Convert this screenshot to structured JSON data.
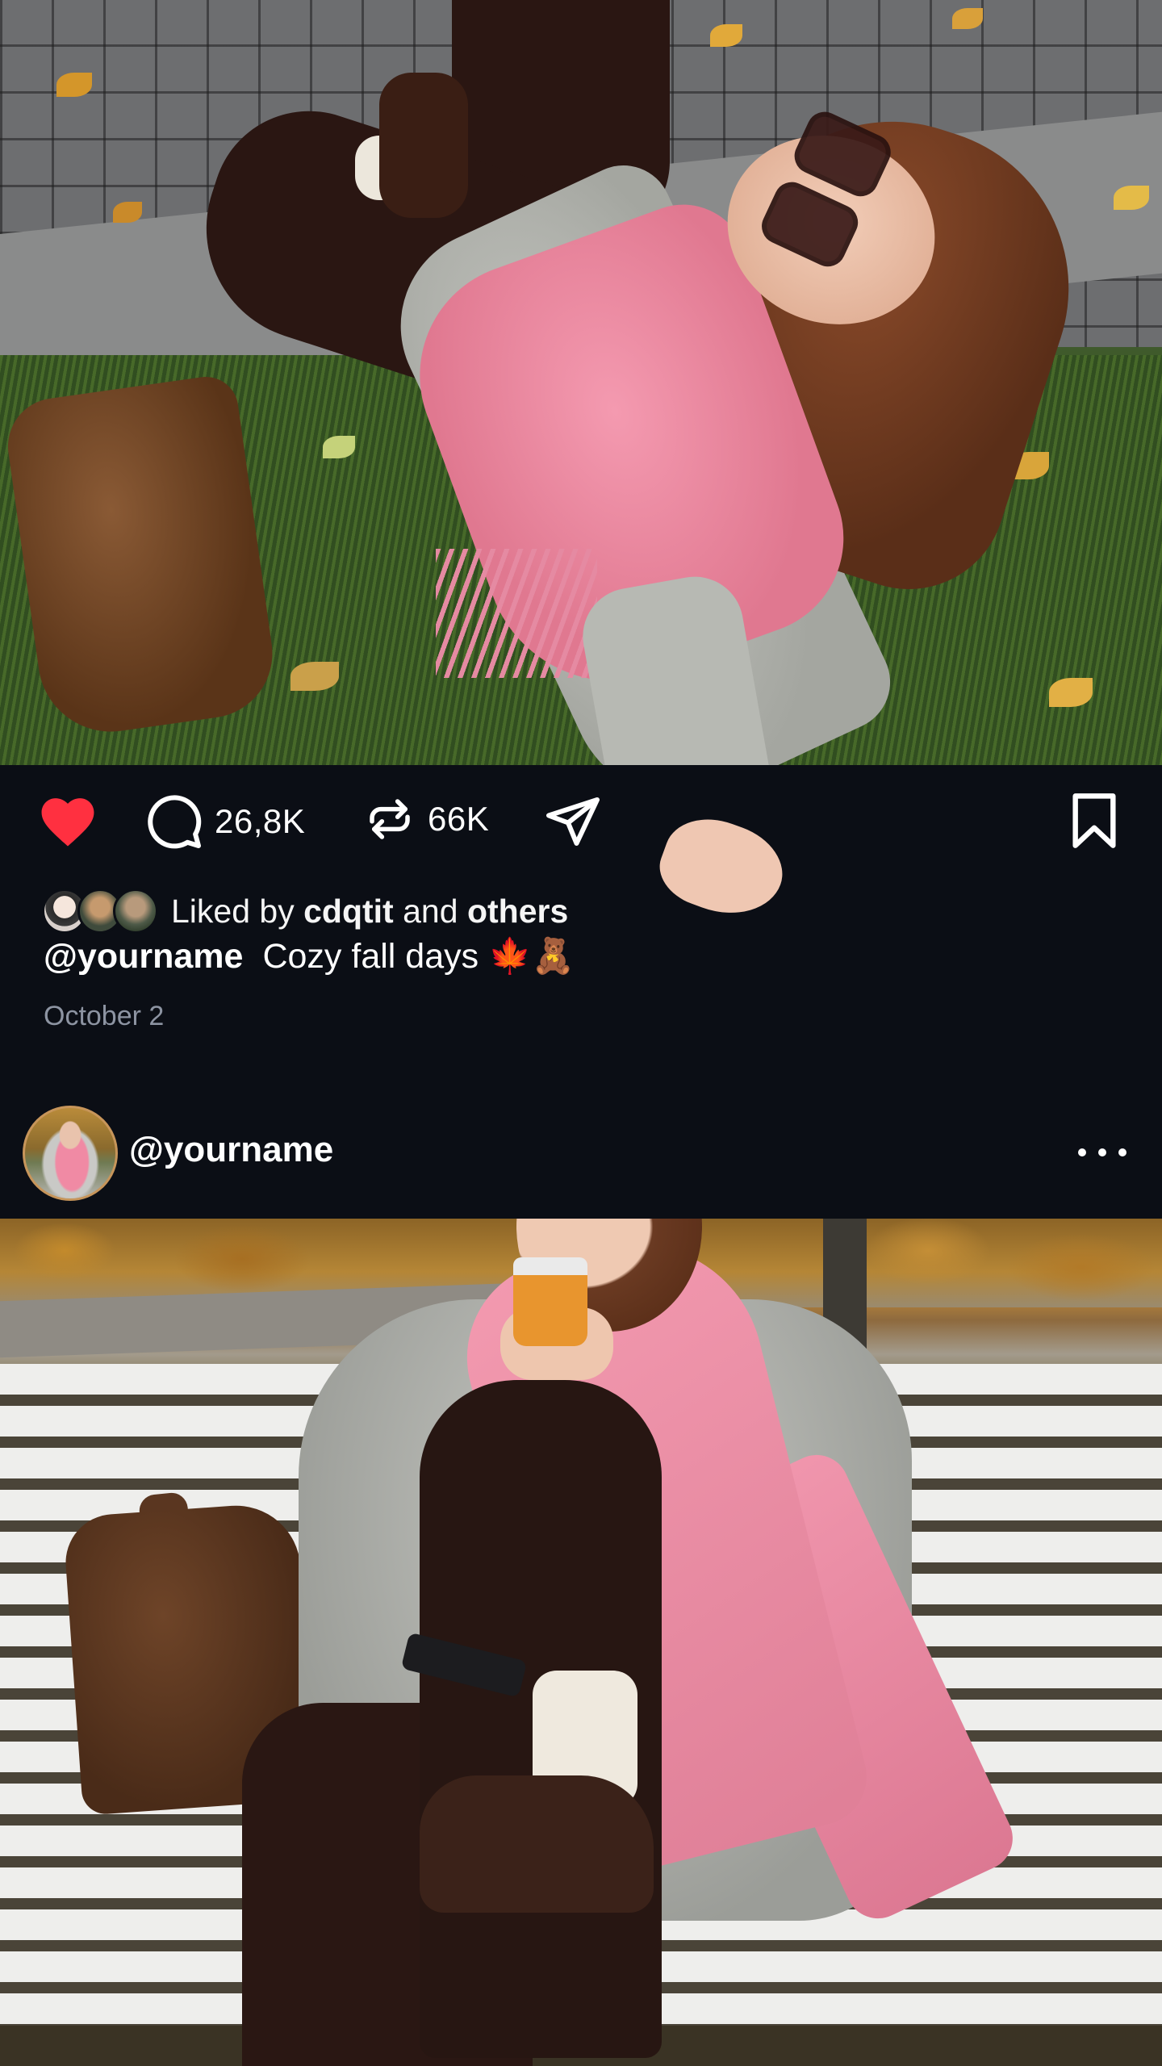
{
  "post1": {
    "actions": {
      "likes_count": "",
      "comments_count": "26,8K",
      "reposts_count": "66K"
    },
    "liked_by": {
      "prefix": "Liked by",
      "user": "cdqtit",
      "conjunction": "and",
      "others": "others"
    },
    "caption": {
      "username": "@yourname",
      "text": "Cozy fall days 🍁🧸"
    },
    "date": "October 2"
  },
  "post2": {
    "username": "@yourname"
  },
  "colors": {
    "background": "#0b0e15",
    "like_red": "#ff3040",
    "text_primary": "#ffffff",
    "text_secondary": "#8d94a2"
  },
  "icons": {
    "like": "heart-filled-icon",
    "comment": "comment-bubble-icon",
    "repost": "repost-icon",
    "share": "paper-plane-icon",
    "save": "bookmark-icon",
    "more": "more-horizontal-icon"
  }
}
